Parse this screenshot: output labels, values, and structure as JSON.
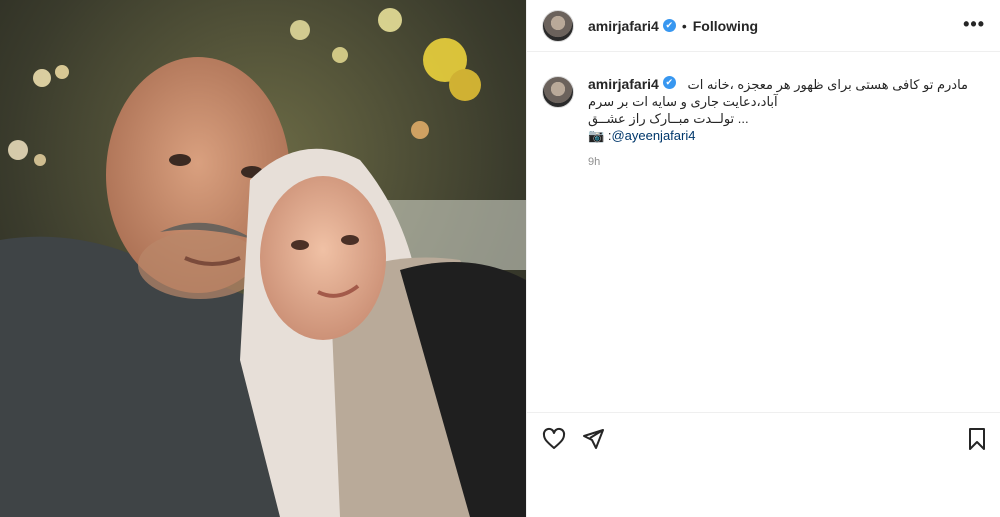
{
  "header": {
    "username": "amirjafari4",
    "verified_mark": "✔",
    "separator": "•",
    "follow_status": "Following",
    "more_label": "•••"
  },
  "caption": {
    "username": "amirjafari4",
    "line1": "مادرم تو کافی هستی برای ظهور هر معجزه ،خانه ات",
    "line2": "آباد،دعایت جاری و سایه ات بر سرم",
    "line3": "... تولــدت مبــارک راز عشــق",
    "camera_emoji": "📷",
    "mention_prefix": ":",
    "mention": "@ayeenjafari4",
    "time": "9h"
  },
  "actions": {
    "icons": [
      "heart-icon",
      "share-icon",
      "bookmark-icon"
    ]
  },
  "colors": {
    "verified": "#3897f0",
    "mention": "#00376b",
    "muted": "#8e8e8e",
    "border": "#efefef"
  }
}
